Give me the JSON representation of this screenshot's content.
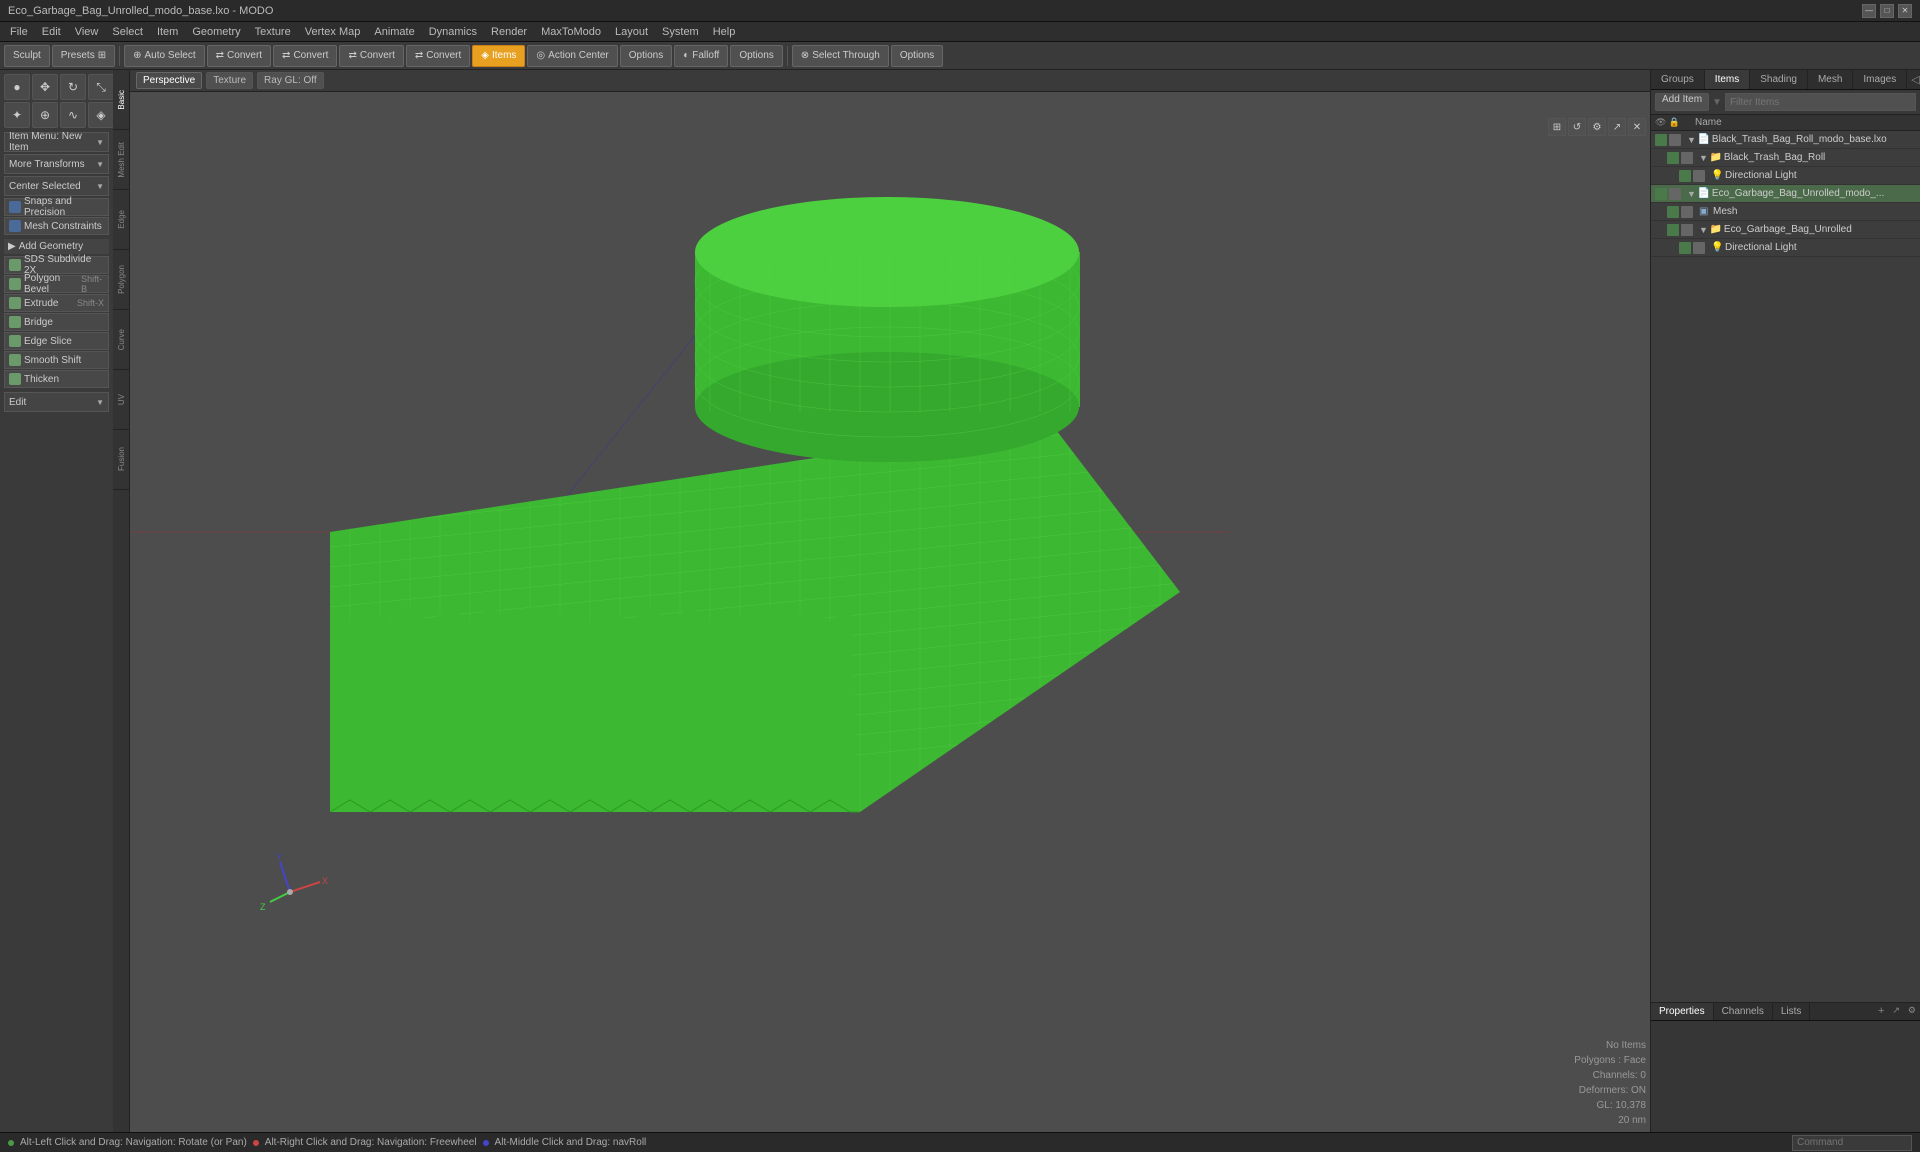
{
  "window": {
    "title": "Eco_Garbage_Bag_Unrolled_modo_base.lxo - MODO"
  },
  "titlebar": {
    "controls": [
      "—",
      "□",
      "✕"
    ]
  },
  "menu": {
    "items": [
      "File",
      "Edit",
      "View",
      "Select",
      "Item",
      "Geometry",
      "Texture",
      "Vertex Map",
      "Animate",
      "Dynamics",
      "Render",
      "MaxToModo",
      "Layout",
      "System",
      "Help"
    ]
  },
  "toolbar": {
    "sculpt_label": "Sculpt",
    "presets_label": "Presets",
    "buttons": [
      {
        "label": "Auto Select",
        "icon": "⊕",
        "active": false
      },
      {
        "label": "Convert",
        "icon": "⇄",
        "active": false
      },
      {
        "label": "Convert",
        "icon": "⇄",
        "active": false
      },
      {
        "label": "Convert",
        "icon": "⇄",
        "active": false
      },
      {
        "label": "Convert",
        "icon": "⇄",
        "active": false
      },
      {
        "label": "Items",
        "icon": "◈",
        "active": true
      },
      {
        "label": "Action Center",
        "icon": "◎",
        "active": false
      },
      {
        "label": "Options",
        "icon": "",
        "active": false
      },
      {
        "label": "Falloff",
        "icon": "◐",
        "active": false
      },
      {
        "label": "Options",
        "icon": "",
        "active": false
      },
      {
        "label": "Select Through",
        "icon": "⊗",
        "active": false
      },
      {
        "label": "Options",
        "icon": "",
        "active": false
      }
    ]
  },
  "left_sidebar": {
    "tool_icons": [
      {
        "symbol": "●",
        "title": "Select"
      },
      {
        "symbol": "✥",
        "title": "Move"
      },
      {
        "symbol": "↻",
        "title": "Rotate"
      },
      {
        "symbol": "⤡",
        "title": "Scale"
      },
      {
        "symbol": "✦",
        "title": "Transform"
      },
      {
        "symbol": "⊕",
        "title": "Add"
      },
      {
        "symbol": "∿",
        "title": "Smooth"
      },
      {
        "symbol": "◈",
        "title": "UV"
      }
    ],
    "dropdowns": [
      {
        "label": "Item Menu: New Item",
        "id": "item-menu"
      },
      {
        "label": "More Transforms",
        "id": "more-transforms"
      },
      {
        "label": "Center Selected",
        "id": "center-selected"
      }
    ],
    "snaps": {
      "label": "Snaps and Precision",
      "sub": "Mesh Constraints"
    },
    "geometry_section": "Add Geometry",
    "tools": [
      {
        "label": "SDS Subdivide 2X",
        "icon": "green",
        "shortcut": ""
      },
      {
        "label": "Polygon Bevel",
        "icon": "green",
        "shortcut": "Shift-B"
      },
      {
        "label": "Extrude",
        "icon": "green",
        "shortcut": "Shift-X"
      },
      {
        "label": "Bridge",
        "icon": "green",
        "shortcut": ""
      },
      {
        "label": "Edge Slice",
        "icon": "green",
        "shortcut": ""
      },
      {
        "label": "Smooth Shift",
        "icon": "green",
        "shortcut": ""
      },
      {
        "label": "Thicken",
        "icon": "green",
        "shortcut": ""
      }
    ],
    "edit_dropdown": "Edit",
    "vtabs": [
      "Basic",
      "Mesh Edit",
      "Edge",
      "Polygon",
      "Curve",
      "UV",
      "Fusion"
    ]
  },
  "viewport": {
    "tabs": [
      {
        "label": "Perspective",
        "active": true
      },
      {
        "label": "Texture",
        "active": false
      },
      {
        "label": "Ray GL: Off",
        "active": false
      }
    ],
    "corner_icons": [
      "⊞",
      "↺",
      "⚙",
      "↗",
      "✕"
    ],
    "info": {
      "no_items": "No Items",
      "polygons_face": "Polygons : Face",
      "channels": "Channels: 0",
      "deformers": "Deformers: ON",
      "gl": "GL: 10,378",
      "unit": "20 nm"
    }
  },
  "right_panel": {
    "tabs": [
      "Groups",
      "Items",
      "Shading",
      "Mesh",
      "Images"
    ],
    "active_tab": "Items",
    "toolbar": {
      "add_item": "Add Item",
      "filter_placeholder": "Filter Items"
    },
    "items_columns": [
      "",
      "Name"
    ],
    "items_tree": [
      {
        "id": "root1",
        "label": "Black_Trash_Bag_Roll_modo_base.lxo",
        "level": 0,
        "expanded": true,
        "type": "file"
      },
      {
        "id": "child1",
        "label": "Black_Trash_Bag_Roll",
        "level": 1,
        "expanded": true,
        "type": "group"
      },
      {
        "id": "child1a",
        "label": "Directional Light",
        "level": 2,
        "expanded": false,
        "type": "light"
      },
      {
        "id": "root2",
        "label": "Eco_Garbage_Bag_Unrolled_modo_...",
        "level": 0,
        "expanded": true,
        "type": "file",
        "selected": true
      },
      {
        "id": "root2a",
        "label": "Mesh",
        "level": 1,
        "expanded": false,
        "type": "mesh"
      },
      {
        "id": "root2b",
        "label": "Eco_Garbage_Bag_Unrolled",
        "level": 1,
        "expanded": false,
        "type": "group"
      },
      {
        "id": "root2c",
        "label": "Directional Light",
        "level": 2,
        "expanded": false,
        "type": "light"
      }
    ],
    "bottom_tabs": [
      "Properties",
      "Channels",
      "Lists"
    ],
    "active_bottom_tab": "Properties"
  },
  "status_bar": {
    "left": "Alt-Left Click and Drag: Navigation: Rotate (or Pan)",
    "mid": "Alt-Right Click and Drag: Navigation: Freewheel",
    "right": "Alt-Middle Click and Drag: navRoll",
    "command_placeholder": "Command"
  }
}
